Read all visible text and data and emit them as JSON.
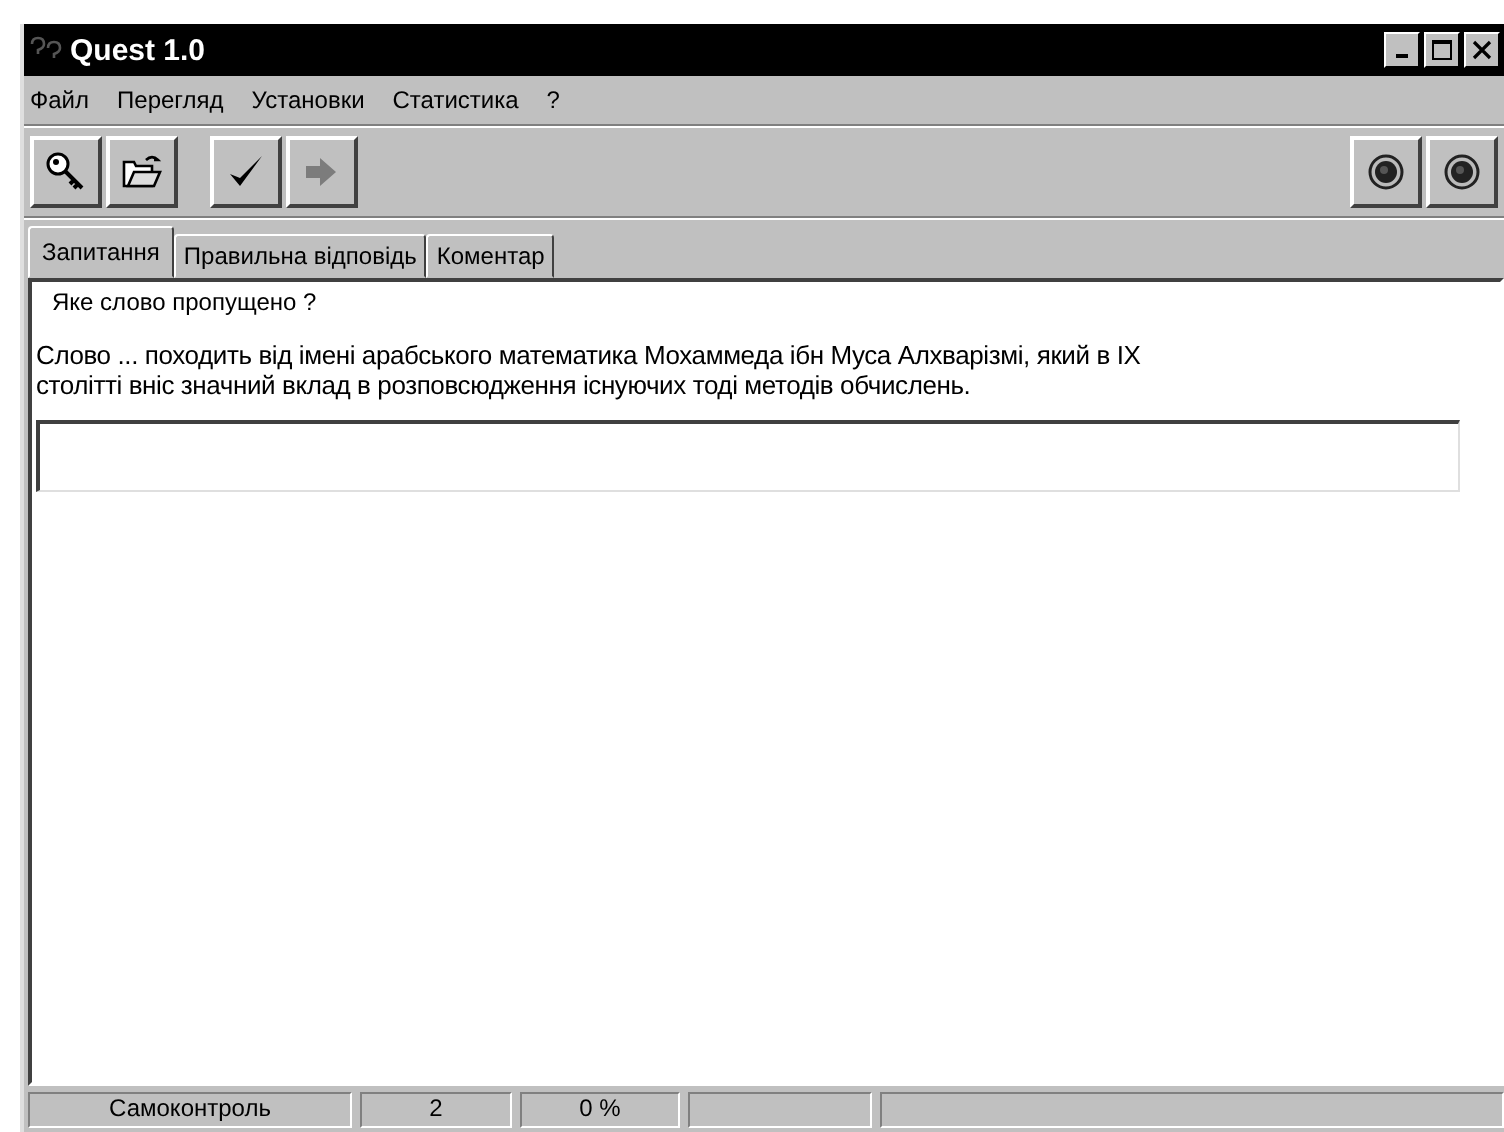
{
  "window": {
    "title": "Quest 1.0"
  },
  "menu": [
    "Файл",
    "Перегляд",
    "Установки",
    "Статистика",
    "?"
  ],
  "toolbar": [
    {
      "kind": "key",
      "disabled": false
    },
    {
      "kind": "open",
      "disabled": false
    },
    {
      "kind": "gap"
    },
    {
      "kind": "check",
      "disabled": false
    },
    {
      "kind": "next",
      "disabled": true
    }
  ],
  "toolbar_right": [
    {
      "kind": "record"
    },
    {
      "kind": "record"
    }
  ],
  "tabs": [
    {
      "label": "Запитання",
      "selected": true
    },
    {
      "label": "Правильна відповідь",
      "selected": false
    },
    {
      "label": "Коментар",
      "selected": false
    }
  ],
  "question": {
    "heading": "Яке слово пропущено ?",
    "text": "Слово ... походить від імені арабського математика Мохаммеда ібн Муса Алхварізмі, який в IX столітті вніс значний вклад в розповсюдження існуючих тоді методів обчислень."
  },
  "status_bar": [
    "Самоконтроль",
    "2",
    "0 %"
  ]
}
